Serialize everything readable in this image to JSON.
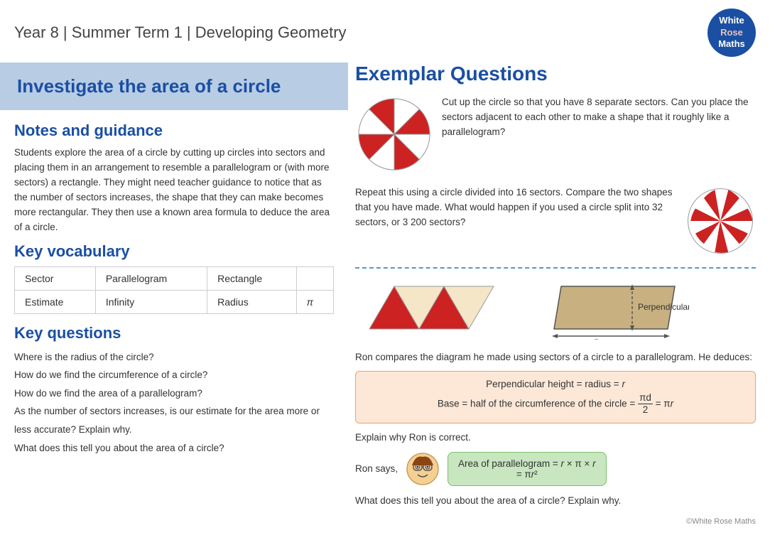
{
  "header": {
    "title": "Year 8 |  Summer Term  1 | Developing Geometry",
    "logo_line1": "White",
    "logo_line2": "Rose",
    "logo_line3": "Maths"
  },
  "left": {
    "banner": "Investigate the area of a circle",
    "notes_heading": "Notes and guidance",
    "notes_text": "Students explore the area of a circle by cutting up circles into sectors and placing them in an arrangement to resemble a parallelogram or (with more sectors) a rectangle. They might need teacher guidance to notice that as the number of sectors increases, the shape that they can make becomes more rectangular. They then use a known area formula to deduce the area of a circle.",
    "vocab_heading": "Key vocabulary",
    "vocab": [
      [
        "Sector",
        "Parallelogram",
        "Rectangle"
      ],
      [
        "Estimate",
        "Infinity",
        "Radius",
        "π"
      ]
    ],
    "questions_heading": "Key questions",
    "questions": [
      "Where is the radius of the circle?",
      "How do we find the circumference of a circle?",
      "How do we find the area of a parallelogram?",
      "As the number of sectors increases, is our estimate for the area more or less accurate? Explain why.",
      "What does this tell you about the area of a circle?"
    ]
  },
  "right": {
    "exemplar_heading": "Exemplar Questions",
    "q1_text": "Cut up the circle so that you have 8 separate sectors. Can you place the sectors adjacent to each other to make a shape that it roughly like a parallelogram?",
    "q2_text": "Repeat this using a circle divided into 16 sectors. Compare the two shapes that you have made. What would happen if you used a circle split into 32 sectors, or 3 200 sectors?",
    "perpendicular_height": "Perpendicular height",
    "base_label": "Base",
    "ron_prefix": "Ron compares the diagram he made using sectors of a circle to a parallelogram. He deduces:",
    "deduction_line1": "Perpendicular height = radius = r",
    "deduction_line2": "Base = half of the circumference of the circle = πd/2 = πr",
    "explain_text": "Explain why Ron is correct.",
    "ron_says": "Ron says,",
    "speech_line1": "Area of parallelogram = r × π × r",
    "speech_line2": "= πr²",
    "final_question": "What does this tell you about the area of a circle?  Explain why.",
    "copyright": "©White Rose Maths"
  }
}
